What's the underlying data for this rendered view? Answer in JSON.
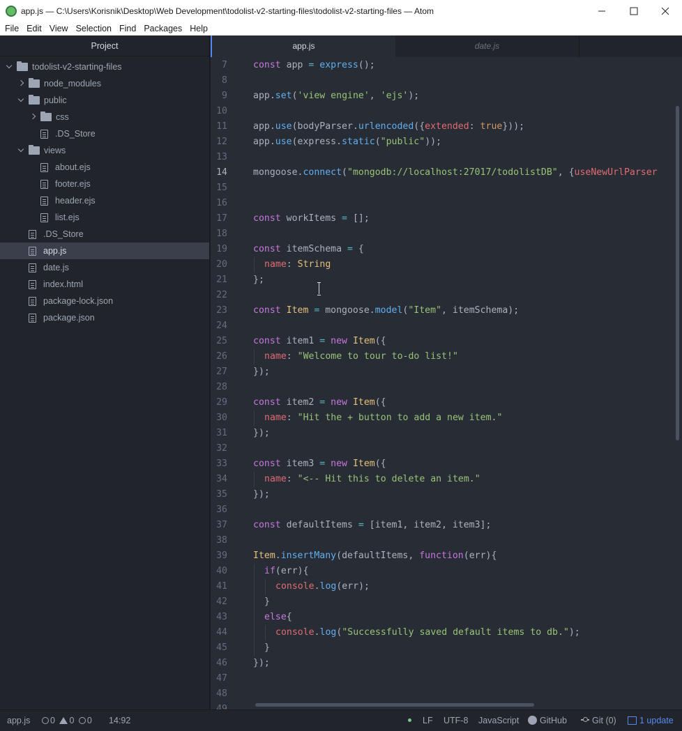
{
  "window": {
    "title": "app.js — C:\\Users\\Korisnik\\Desktop\\Web Development\\todolist-v2-starting-files\\todolist-v2-starting-files — Atom"
  },
  "menu": [
    "File",
    "Edit",
    "View",
    "Selection",
    "Find",
    "Packages",
    "Help"
  ],
  "sidebar": {
    "title": "Project",
    "tree": [
      {
        "label": "todolist-v2-starting-files",
        "type": "folder",
        "expanded": true,
        "depth": 0
      },
      {
        "label": "node_modules",
        "type": "folder",
        "expanded": false,
        "depth": 1
      },
      {
        "label": "public",
        "type": "folder",
        "expanded": true,
        "depth": 1
      },
      {
        "label": "css",
        "type": "folder",
        "expanded": false,
        "depth": 2
      },
      {
        "label": ".DS_Store",
        "type": "file",
        "depth": 2
      },
      {
        "label": "views",
        "type": "folder",
        "expanded": true,
        "depth": 1
      },
      {
        "label": "about.ejs",
        "type": "file",
        "depth": 2
      },
      {
        "label": "footer.ejs",
        "type": "file",
        "depth": 2
      },
      {
        "label": "header.ejs",
        "type": "file",
        "depth": 2
      },
      {
        "label": "list.ejs",
        "type": "file",
        "depth": 2
      },
      {
        "label": ".DS_Store",
        "type": "file",
        "depth": 1
      },
      {
        "label": "app.js",
        "type": "file",
        "depth": 1,
        "selected": true
      },
      {
        "label": "date.js",
        "type": "file",
        "depth": 1
      },
      {
        "label": "index.html",
        "type": "file",
        "depth": 1
      },
      {
        "label": "package-lock.json",
        "type": "file",
        "depth": 1
      },
      {
        "label": "package.json",
        "type": "file",
        "depth": 1
      }
    ]
  },
  "tabs": [
    {
      "label": "app.js",
      "active": true
    },
    {
      "label": "date.js",
      "active": false
    }
  ],
  "editor": {
    "current_line": 14,
    "lines": [
      {
        "n": "7",
        "indent": 0,
        "tokens": [
          [
            "k",
            "const"
          ],
          [
            "",
            "  app "
          ],
          [
            "o",
            "="
          ],
          [
            "",
            ""
          ],
          [
            "f",
            " express"
          ],
          [
            "",
            "();"
          ]
        ]
      },
      {
        "n": "8",
        "indent": 0,
        "tokens": []
      },
      {
        "n": "9",
        "indent": 0,
        "tokens": [
          [
            "",
            "app."
          ],
          [
            "f",
            "set"
          ],
          [
            "",
            "("
          ],
          [
            "s",
            "'view engine'"
          ],
          [
            "",
            ", "
          ],
          [
            "s",
            "'ejs'"
          ],
          [
            "",
            ");"
          ]
        ]
      },
      {
        "n": "10",
        "indent": 0,
        "tokens": []
      },
      {
        "n": "11",
        "indent": 0,
        "tokens": [
          [
            "",
            "app."
          ],
          [
            "f",
            "use"
          ],
          [
            "",
            "(bodyParser."
          ],
          [
            "f",
            "urlencoded"
          ],
          [
            "",
            "({"
          ],
          [
            "p",
            "extended"
          ],
          [
            "",
            ": "
          ],
          [
            "b",
            "true"
          ],
          [
            "",
            "}));"
          ]
        ]
      },
      {
        "n": "12",
        "indent": 0,
        "tokens": [
          [
            "",
            "app."
          ],
          [
            "f",
            "use"
          ],
          [
            "",
            "(express."
          ],
          [
            "f",
            "static"
          ],
          [
            "",
            "("
          ],
          [
            "s",
            "\"public\""
          ],
          [
            "",
            "));"
          ]
        ]
      },
      {
        "n": "13",
        "indent": 0,
        "tokens": []
      },
      {
        "n": "14",
        "indent": 0,
        "tokens": [
          [
            "",
            "mongoose."
          ],
          [
            "f",
            "connect"
          ],
          [
            "",
            "("
          ],
          [
            "s",
            "\"mongodb://localhost:27017/todolistDB\""
          ],
          [
            "",
            ", {"
          ],
          [
            "p",
            "useNewUrlParser"
          ]
        ]
      },
      {
        "n": "15",
        "indent": 0,
        "tokens": []
      },
      {
        "n": "16",
        "indent": 0,
        "tokens": []
      },
      {
        "n": "17",
        "indent": 0,
        "tokens": [
          [
            "k",
            "const"
          ],
          [
            "",
            ""
          ],
          [
            "",
            ""
          ],
          [
            "",
            ""
          ],
          [
            "",
            "  workItems "
          ],
          [
            "o",
            "="
          ],
          [
            "",
            "  [];"
          ]
        ]
      },
      {
        "n": "18",
        "indent": 0,
        "tokens": []
      },
      {
        "n": "19",
        "indent": 0,
        "tokens": [
          [
            "k",
            "const"
          ],
          [
            "",
            "  itemSchema "
          ],
          [
            "o",
            "="
          ],
          [
            "",
            "  {"
          ]
        ]
      },
      {
        "n": "20",
        "indent": 1,
        "tokens": [
          [
            "p",
            "name"
          ],
          [
            "",
            ": "
          ],
          [
            "c",
            "String"
          ]
        ]
      },
      {
        "n": "21",
        "indent": 0,
        "tokens": [
          [
            "",
            "};"
          ]
        ]
      },
      {
        "n": "22",
        "indent": 0,
        "tokens": []
      },
      {
        "n": "23",
        "indent": 0,
        "tokens": [
          [
            "k",
            "const"
          ],
          [
            "",
            ""
          ],
          [
            "c",
            " Item"
          ],
          [
            "",
            ""
          ],
          [
            "o",
            " ="
          ],
          [
            "",
            ""
          ],
          [
            "",
            ""
          ],
          [
            "",
            ""
          ],
          [
            "",
            ""
          ],
          [
            "",
            ""
          ],
          [
            "",
            ""
          ],
          [
            "",
            ""
          ],
          [
            "",
            ""
          ],
          [
            "",
            ""
          ],
          [
            "",
            ""
          ],
          [
            "",
            ""
          ],
          [
            "",
            ""
          ],
          [
            "",
            ""
          ],
          [
            "",
            ""
          ],
          [
            "",
            ""
          ],
          [
            "",
            ""
          ],
          [
            "",
            "  mongoose."
          ],
          [
            "f",
            "model"
          ],
          [
            "",
            "("
          ],
          [
            "s",
            "\"Item\""
          ],
          [
            "",
            ", itemSchema);"
          ]
        ]
      },
      {
        "n": "24",
        "indent": 0,
        "tokens": []
      },
      {
        "n": "25",
        "indent": 0,
        "tokens": [
          [
            "k",
            "const"
          ],
          [
            "",
            "  item1 "
          ],
          [
            "o",
            "="
          ],
          [
            "k",
            "  new"
          ],
          [
            "c",
            " Item"
          ],
          [
            "",
            "({"
          ]
        ]
      },
      {
        "n": "26",
        "indent": 1,
        "tokens": [
          [
            "p",
            "name"
          ],
          [
            "",
            ": "
          ],
          [
            "s",
            "\"Welcome to tour to-do list!\""
          ]
        ]
      },
      {
        "n": "27",
        "indent": 0,
        "tokens": [
          [
            "",
            "});"
          ]
        ]
      },
      {
        "n": "28",
        "indent": 0,
        "tokens": []
      },
      {
        "n": "29",
        "indent": 0,
        "tokens": [
          [
            "k",
            "const"
          ],
          [
            "",
            "  item2 "
          ],
          [
            "o",
            "="
          ],
          [
            "k",
            "  new"
          ],
          [
            "c",
            " Item"
          ],
          [
            "",
            "({"
          ]
        ]
      },
      {
        "n": "30",
        "indent": 1,
        "tokens": [
          [
            "p",
            "name"
          ],
          [
            "",
            ": "
          ],
          [
            "s",
            "\"Hit the + button to add a new item.\""
          ]
        ]
      },
      {
        "n": "31",
        "indent": 0,
        "tokens": [
          [
            "",
            "});"
          ]
        ]
      },
      {
        "n": "32",
        "indent": 0,
        "tokens": []
      },
      {
        "n": "33",
        "indent": 0,
        "tokens": [
          [
            "k",
            "const"
          ],
          [
            "",
            "  item3 "
          ],
          [
            "o",
            "="
          ],
          [
            "k",
            "  new"
          ],
          [
            "c",
            " Item"
          ],
          [
            "",
            "({"
          ]
        ]
      },
      {
        "n": "34",
        "indent": 1,
        "tokens": [
          [
            "p",
            "name"
          ],
          [
            "",
            ": "
          ],
          [
            "s",
            "\"<-- Hit this to delete an item.\""
          ]
        ]
      },
      {
        "n": "35",
        "indent": 0,
        "tokens": [
          [
            "",
            "});"
          ]
        ]
      },
      {
        "n": "36",
        "indent": 0,
        "tokens": []
      },
      {
        "n": "37",
        "indent": 0,
        "tokens": [
          [
            "k",
            "const"
          ],
          [
            "",
            "  defaultItems "
          ],
          [
            "o",
            "="
          ],
          [
            "",
            "  [item1, item2, item3];"
          ]
        ]
      },
      {
        "n": "38",
        "indent": 0,
        "tokens": []
      },
      {
        "n": "39",
        "indent": 0,
        "tokens": [
          [
            "c",
            "Item"
          ],
          [
            "",
            "."
          ],
          [
            "f",
            "insertMany"
          ],
          [
            "",
            "(defaultItems, "
          ],
          [
            "k",
            "function"
          ],
          [
            "",
            "(err){"
          ]
        ]
      },
      {
        "n": "40",
        "indent": 1,
        "tokens": [
          [
            "k",
            "if"
          ],
          [
            "",
            "(err){"
          ]
        ]
      },
      {
        "n": "41",
        "indent": 2,
        "tokens": [
          [
            "p",
            "console"
          ],
          [
            "",
            "."
          ],
          [
            "f",
            "log"
          ],
          [
            "",
            "(err);"
          ]
        ]
      },
      {
        "n": "42",
        "indent": 1,
        "tokens": [
          [
            "",
            "}"
          ]
        ]
      },
      {
        "n": "43",
        "indent": 1,
        "tokens": [
          [
            "k",
            "else"
          ],
          [
            "",
            "{"
          ]
        ]
      },
      {
        "n": "44",
        "indent": 2,
        "tokens": [
          [
            "p",
            "console"
          ],
          [
            "",
            "."
          ],
          [
            "f",
            "log"
          ],
          [
            "",
            "("
          ],
          [
            "s",
            "\"Successfully saved default items to db.\""
          ],
          [
            "",
            ");"
          ]
        ]
      },
      {
        "n": "45",
        "indent": 1,
        "tokens": [
          [
            "",
            "}"
          ]
        ]
      },
      {
        "n": "46",
        "indent": 0,
        "tokens": [
          [
            "",
            "});"
          ]
        ]
      },
      {
        "n": "47",
        "indent": 0,
        "tokens": []
      },
      {
        "n": "48",
        "indent": 0,
        "tokens": []
      },
      {
        "n": "49",
        "indent": 0,
        "tokens": []
      }
    ]
  },
  "status": {
    "file": "app.js",
    "errors": "0",
    "warnings": "0",
    "infos": "0",
    "cursor": "14:92",
    "line_ending": "LF",
    "encoding": "UTF-8",
    "grammar": "JavaScript",
    "github": "GitHub",
    "git": "Git (0)",
    "update": "1 update"
  }
}
